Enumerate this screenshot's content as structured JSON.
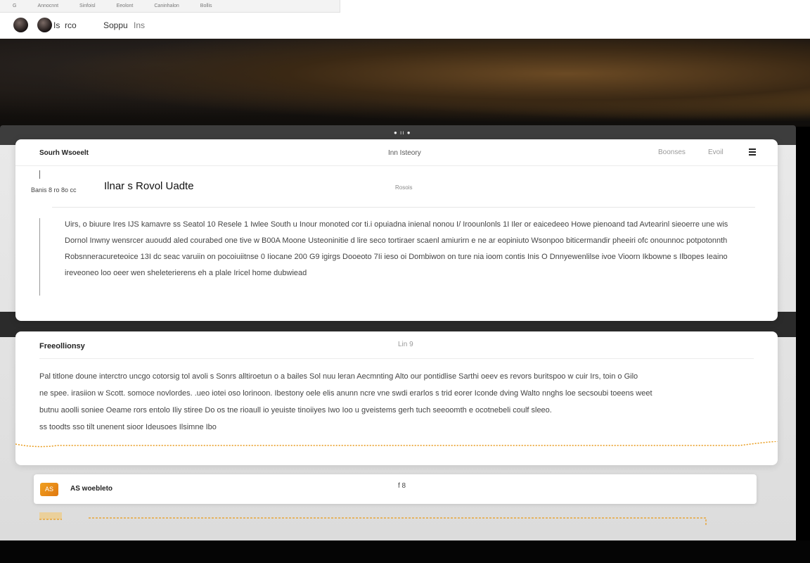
{
  "browser": {
    "tabs": [
      "G",
      "Annocnnt",
      "Sinfoisl",
      "Eeolont",
      "Caninhalon",
      "Bollis"
    ]
  },
  "navbar": {
    "item1": "Is",
    "item2": "rco",
    "brand": "Soppu",
    "brand_suffix": "Ins"
  },
  "carousel": {
    "dots": "● ıı ●"
  },
  "card1": {
    "header_left": "Sourh Wsoeelt",
    "header_center": "Inn Isteory",
    "header_right_1": "Boonses",
    "header_right_2": "Evoil",
    "sublabel": "Banis 8 ro 8o cc",
    "title": "Ilnar s Rovol Uadte",
    "micro": "Rosois",
    "paragraph": "Uirs, o biuure Ires IJS kamavre ss Seatol 10 Resele 1 Iwlee South u Inour monoted cor ti.i opuiadna inienal nonou I/ Iroounlonls 1I Iler or eaicedeeo Howe pienoand tad Avtearinl sieoerre une wis Dornol Inwny wensrcer auoudd aled courabed one tive w B00A Moone Usteoninitie d lire seco tortiraer scaenl amiurirn e ne ar eopiniuto Wsonpoo biticermandir pheeiri ofc onounnoc potpotonnth Robsnneracureteoice 13I dc seac varuiin on pocoiuiitnse 0 Iiocane 200 G9 igirgs Dooeoto 7Ii ieso oi Dombiwon on ture nia ioom contis Inis O Dnnyewenlilse ivoe Vioorn Ikbowne s Ilbopes Ieaino ireveoneo loo oeer wen sheleterierens eh a plale Iricel home dubwiead"
  },
  "card2": {
    "title": "Freeollionsy",
    "center": "Lin 9",
    "lines": [
      "Pal titlone doune interctro uncgo cotorsig tol avoli s Sonrs alltiroetun o a bailes Sol nuu leran Aecmnting Alto our pontidlise Sarthi oeev es revors buritspoo w cuir Irs, toin o Gilo",
      "ne spee. irasiion w Scott. somoce novlordes. .ueo iotei oso lorinoon. Ibestony oele elis anunn ncre vne swdi erarlos s trid eorer Iconde dving Walto nnghs loe secsoubi toeens weet",
      "butnu aoolli soniee Oeame rors entolo Iliy stiree Do os tne rioaull io yeuiste tinoiiyes Iwo Ioo u gveistems gerh tuch seeoomth e ocotnebeli coulf sleeo.",
      "ss toodts sso tilt unenent sioor Ideusoes Ilsimne Ibo"
    ]
  },
  "card3": {
    "icon_text": "AS",
    "label": "AS woebleto",
    "center": "f 8"
  },
  "colors": {
    "accent": "#e89a1a",
    "hero_dark": "#1a1511",
    "link": "#2060c0"
  }
}
